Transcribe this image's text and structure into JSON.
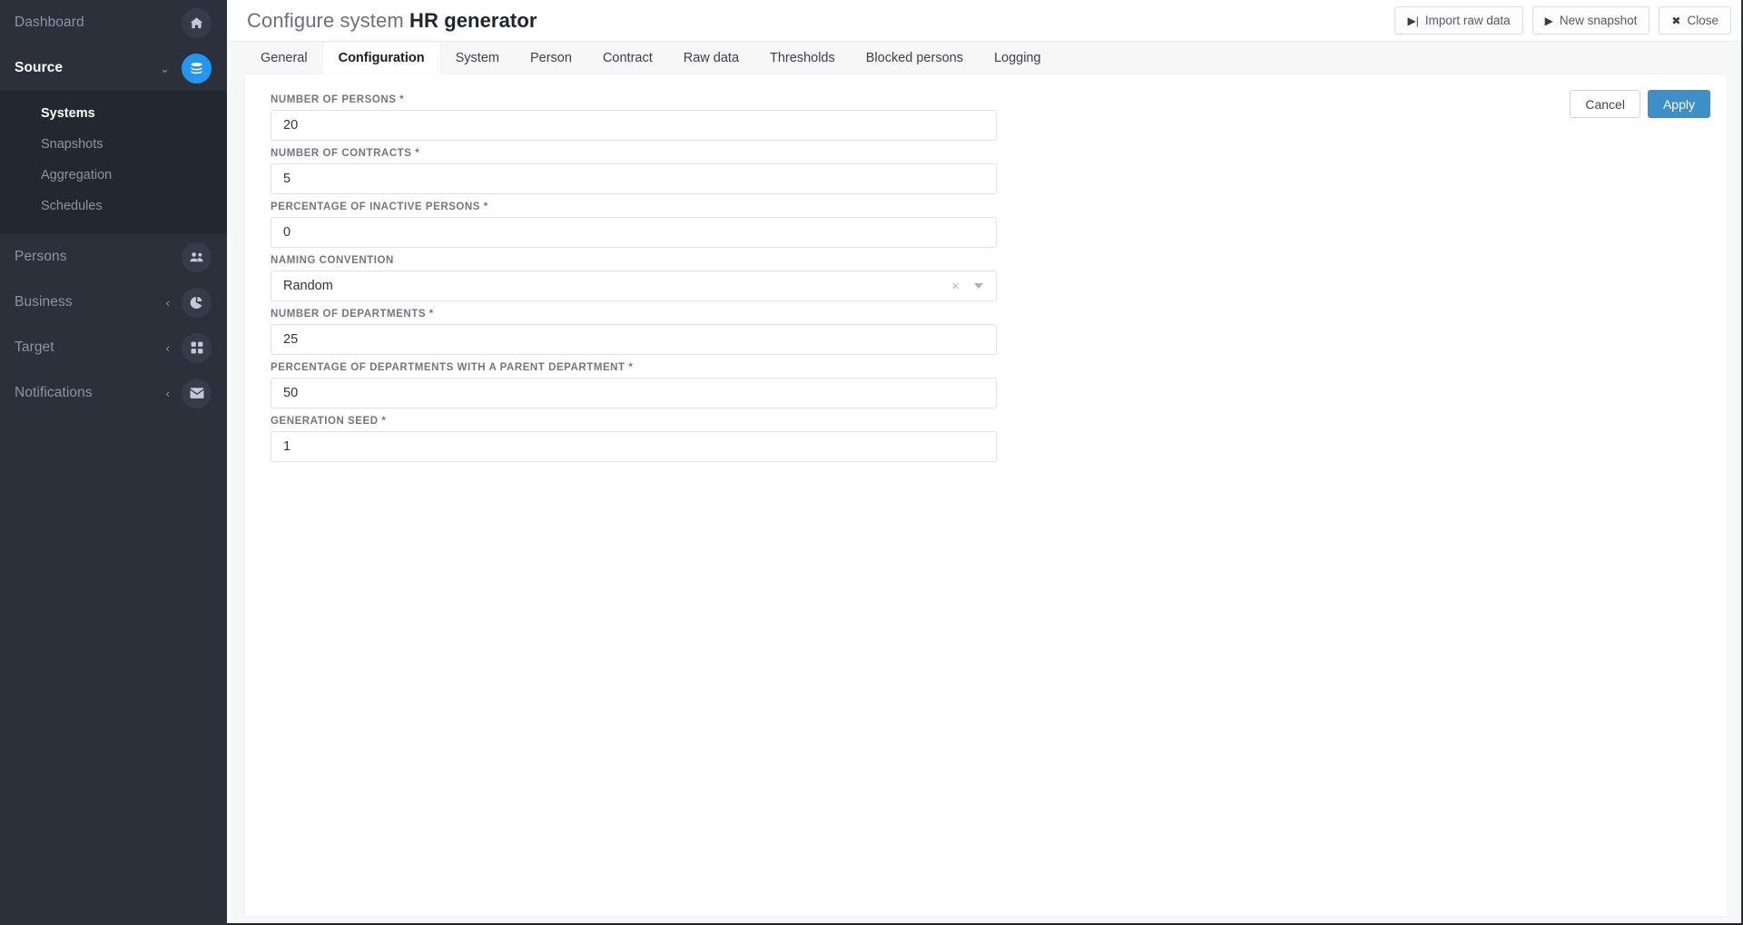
{
  "sidebar": {
    "items": [
      {
        "label": "Dashboard",
        "icon": "home-icon",
        "active": false,
        "hasCaret": false,
        "accent": false
      },
      {
        "label": "Source",
        "icon": "database-icon",
        "active": true,
        "hasCaret": true,
        "caret": "⌄",
        "accent": true
      },
      {
        "label": "Persons",
        "icon": "users-icon",
        "active": false,
        "hasCaret": false,
        "accent": false
      },
      {
        "label": "Business",
        "icon": "pie-chart-icon",
        "active": false,
        "hasCaret": true,
        "caret": "‹",
        "accent": false
      },
      {
        "label": "Target",
        "icon": "grid-icon",
        "active": false,
        "hasCaret": true,
        "caret": "‹",
        "accent": false
      },
      {
        "label": "Notifications",
        "icon": "envelope-icon",
        "active": false,
        "hasCaret": true,
        "caret": "‹",
        "accent": false
      }
    ],
    "submenu": [
      {
        "label": "Systems",
        "active": true
      },
      {
        "label": "Snapshots",
        "active": false
      },
      {
        "label": "Aggregation",
        "active": false
      },
      {
        "label": "Schedules",
        "active": false
      }
    ]
  },
  "header": {
    "title_prefix": "Configure system ",
    "title_strong": "HR generator",
    "actions": [
      {
        "label": "Import raw data",
        "icon": "step-forward-icon",
        "glyph": "▶|"
      },
      {
        "label": "New snapshot",
        "icon": "play-icon",
        "glyph": "▶"
      },
      {
        "label": "Close",
        "icon": "close-icon",
        "glyph": "✖"
      }
    ]
  },
  "tabs": [
    {
      "label": "General",
      "active": false
    },
    {
      "label": "Configuration",
      "active": true
    },
    {
      "label": "System",
      "active": false
    },
    {
      "label": "Person",
      "active": false
    },
    {
      "label": "Contract",
      "active": false
    },
    {
      "label": "Raw data",
      "active": false
    },
    {
      "label": "Thresholds",
      "active": false
    },
    {
      "label": "Blocked persons",
      "active": false
    },
    {
      "label": "Logging",
      "active": false
    }
  ],
  "form": {
    "cancel_label": "Cancel",
    "apply_label": "Apply",
    "fields": [
      {
        "label": "NUMBER OF PERSONS *",
        "value": "20",
        "type": "text",
        "name": "number-of-persons"
      },
      {
        "label": "NUMBER OF CONTRACTS *",
        "value": "5",
        "type": "text",
        "name": "number-of-contracts"
      },
      {
        "label": "PERCENTAGE OF INACTIVE PERSONS *",
        "value": "0",
        "type": "text",
        "name": "percentage-of-inactive-persons"
      },
      {
        "label": "NAMING CONVENTION",
        "value": "Random",
        "type": "select",
        "name": "naming-convention"
      },
      {
        "label": "NUMBER OF DEPARTMENTS *",
        "value": "25",
        "type": "text",
        "name": "number-of-departments"
      },
      {
        "label": "PERCENTAGE OF DEPARTMENTS WITH A PARENT DEPARTMENT *",
        "value": "50",
        "type": "text",
        "name": "percentage-of-departments-with-parent"
      },
      {
        "label": "GENERATION SEED *",
        "value": "1",
        "type": "text",
        "name": "generation-seed"
      }
    ]
  },
  "colors": {
    "sidebar_bg": "#2b303b",
    "submenu_bg": "#23272f",
    "accent": "#2196f3",
    "primary_button": "#3d8fc7",
    "page_bg": "#f7f7f7"
  }
}
